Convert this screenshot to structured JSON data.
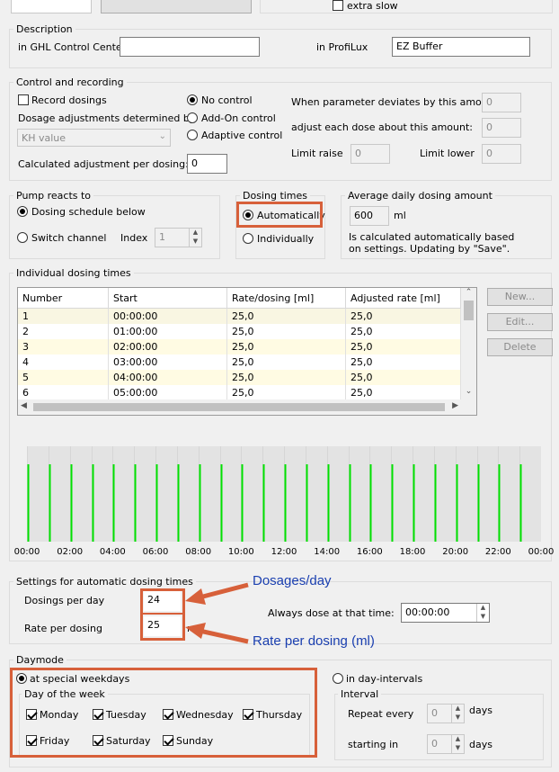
{
  "top": {
    "extra_slow_label": "extra slow"
  },
  "description": {
    "title": "Description",
    "ghl_label": "in GHL Control Center",
    "ghl_value": "",
    "profilux_label": "in ProfiLux",
    "profilux_value": "EZ Buffer"
  },
  "control": {
    "title": "Control and recording",
    "record_label": "Record dosings",
    "adjust_label": "Dosage adjustments determined by",
    "adjust_select": "KH value",
    "calc_label": "Calculated adjustment per dosing:",
    "calc_value": "0",
    "modes": [
      "No control",
      "Add-On control",
      "Adaptive control"
    ],
    "deviates_label": "When parameter deviates by this amount",
    "deviates_value": "0",
    "adjust_dose_label": "adjust each dose about this amount:",
    "adjust_dose_value": "0",
    "limit_raise_label": "Limit raise",
    "limit_raise_value": "0",
    "limit_lower_label": "Limit lower",
    "limit_lower_value": "0"
  },
  "pump": {
    "title": "Pump reacts to",
    "schedule_label": "Dosing schedule below",
    "switch_label": "Switch channel",
    "index_label": "Index",
    "index_value": "1"
  },
  "dosing_times": {
    "title": "Dosing times",
    "auto_label": "Automatically",
    "indiv_label": "Individually"
  },
  "average": {
    "title": "Average daily dosing amount",
    "value": "600",
    "unit": "ml",
    "note": "Is calculated automatically based on settings. Updating by \"Save\"."
  },
  "individual": {
    "title": "Individual dosing times",
    "columns": [
      "Number",
      "Start",
      "Rate/dosing [ml]",
      "Adjusted rate [ml]"
    ],
    "rows": [
      [
        "1",
        "00:00:00",
        "25,0",
        "25,0"
      ],
      [
        "2",
        "01:00:00",
        "25,0",
        "25,0"
      ],
      [
        "3",
        "02:00:00",
        "25,0",
        "25,0"
      ],
      [
        "4",
        "03:00:00",
        "25,0",
        "25,0"
      ],
      [
        "5",
        "04:00:00",
        "25,0",
        "25,0"
      ],
      [
        "6",
        "05:00:00",
        "25,0",
        "25,0"
      ]
    ],
    "buttons": {
      "new": "New...",
      "edit": "Edit...",
      "delete": "Delete"
    }
  },
  "timeline": {
    "tick_labels": [
      "00:00",
      "02:00",
      "04:00",
      "06:00",
      "08:00",
      "10:00",
      "12:00",
      "14:00",
      "16:00",
      "18:00",
      "20:00",
      "22:00",
      "00:00"
    ],
    "dose_hours": [
      0,
      1,
      2,
      3,
      4,
      5,
      6,
      7,
      8,
      9,
      10,
      11,
      12,
      13,
      14,
      15,
      16,
      17,
      18,
      19,
      20,
      21,
      22,
      23
    ],
    "line_color": "#00e000"
  },
  "auto_settings": {
    "title": "Settings for automatic dosing times",
    "dosings_label": "Dosings per day",
    "dosings_value": "24",
    "rate_label": "Rate per dosing",
    "rate_value": "25",
    "rate_unit": "ml",
    "always_label": "Always dose at that time:",
    "always_value": "00:00:00"
  },
  "annotations": {
    "dosages": "Dosages/day",
    "rate": "Rate per dosing (ml)",
    "color": "#d7603a"
  },
  "daymode": {
    "title": "Daymode",
    "weekdays_label": "at special weekdays",
    "interval_mode_label": "in day-intervals",
    "dow_title": "Day of the week",
    "days": [
      "Monday",
      "Tuesday",
      "Wednesday",
      "Thursday",
      "Friday",
      "Saturday",
      "Sunday"
    ],
    "interval_title": "Interval",
    "repeat_label": "Repeat every",
    "repeat_value": "0",
    "repeat_unit": "days",
    "start_label": "starting in",
    "start_value": "0",
    "start_unit": "days"
  }
}
